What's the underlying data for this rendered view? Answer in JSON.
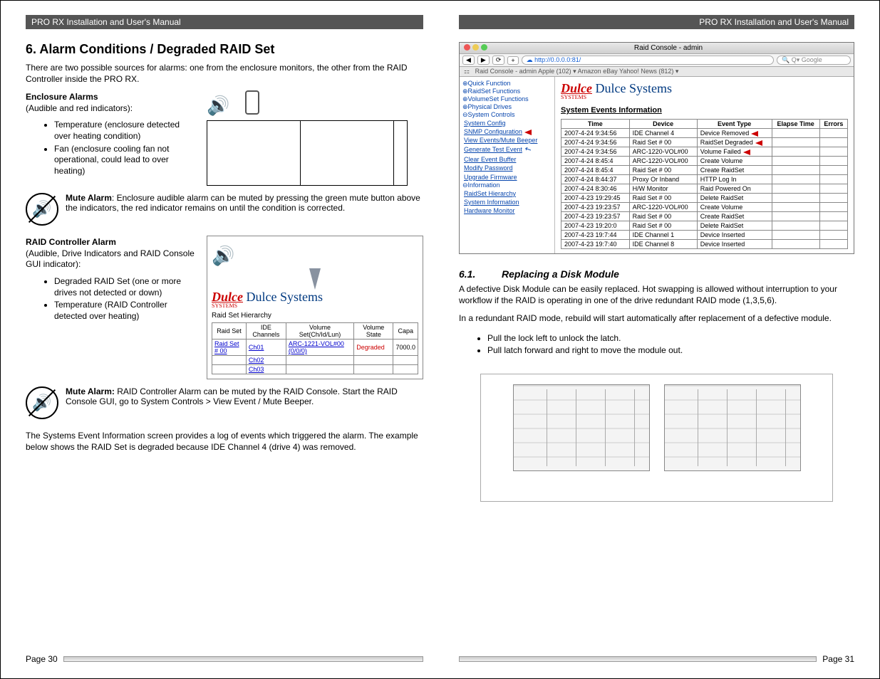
{
  "manual_header": "PRO RX Installation and User's Manual",
  "left": {
    "heading": "6. Alarm Conditions / Degraded RAID Set",
    "intro": "There are two possible sources for alarms: one from the enclosure monitors, the other from the RAID Controller inside the PRO RX.",
    "enc_title": "Enclosure Alarms",
    "enc_sub": "(Audible and red indicators):",
    "enc_bullets": [
      "Temperature (enclosure detected over heating condition)",
      "Fan (enclosure cooling fan not operational, could lead to over heating)"
    ],
    "mute1_lead": "Mute Alarm",
    "mute1": ": Enclosure audible alarm can be muted by pressing the green mute button above the indicators, the red indicator remains on until the condition is corrected.",
    "raid_title": "RAID Controller Alarm",
    "raid_sub": "(Audible, Drive Indicators and RAID Console GUI indicator):",
    "raid_bullets": [
      "Degraded RAID Set (one or more drives not detected or down)",
      "Temperature (RAID Controller detected over heating)"
    ],
    "mute2_lead": "Mute Alarm:",
    "mute2": " RAID Controller Alarm can be muted by the RAID Console.  Start the RAID Console GUI, go to System Controls > View Event / Mute Beeper.",
    "closing": "The Systems Event Information screen provides a log of events which triggered the alarm.  The example below shows the RAID Set is degraded because IDE Channel 4 (drive 4) was removed.",
    "raid_fig": {
      "brand_logo": "Dulce",
      "brand": "Dulce Systems",
      "section": "Raid Set Hierarchy",
      "headers": [
        "Raid Set",
        "IDE Channels",
        "Volume Set(Ch/Id/Lun)",
        "Volume State",
        "Capa"
      ],
      "row": [
        "Raid Set # 00",
        "Ch01",
        "ARC-1221-VOL#00 (0/0/0)",
        "Degraded",
        "7000.0"
      ],
      "extras": [
        "Ch02",
        "Ch03"
      ]
    },
    "page_no": "Page 30"
  },
  "right": {
    "browser": {
      "title": "Raid Console - admin",
      "url": "http://0.0.0.0:81/",
      "search_ph": "Google",
      "bookmarks": "Raid Console - admin    Apple (102) ▾   Amazon   eBay   Yahoo!   News (812) ▾",
      "sidebar_groups": [
        {
          "title": "⊕Quick Function",
          "items": []
        },
        {
          "title": "⊕RaidSet Functions",
          "items": []
        },
        {
          "title": "⊕VolumeSet Functions",
          "items": []
        },
        {
          "title": "⊕Physical Drives",
          "items": []
        },
        {
          "title": "⊖System Controls",
          "items": [
            "System Config",
            "SNMP Configuration",
            "View Events/Mute Beeper",
            "Generate Test Event",
            "Clear Event Buffer",
            "Modify Password",
            "Upgrade Firmware"
          ]
        },
        {
          "title": "⊖Information",
          "items": [
            "RaidSet Hierarchy",
            "System Information",
            "Hardware Monitor"
          ]
        }
      ],
      "brand_logo": "Dulce",
      "brand": "Dulce Systems",
      "table_title": "System Events Information",
      "headers": [
        "Time",
        "Device",
        "Event Type",
        "Elapse Time",
        "Errors"
      ],
      "rows": [
        [
          "2007-4-24 9:34:56",
          "IDE Channel 4",
          "Device Removed",
          "",
          ""
        ],
        [
          "2007-4-24 9:34:56",
          "Raid Set # 00",
          "RaidSet Degraded",
          "",
          ""
        ],
        [
          "2007-4-24 9:34:56",
          "ARC-1220-VOL#00",
          "Volume Failed",
          "",
          ""
        ],
        [
          "2007-4-24 8:45:4",
          "ARC-1220-VOL#00",
          "Create Volume",
          "",
          ""
        ],
        [
          "2007-4-24 8:45:4",
          "Raid Set # 00",
          "Create RaidSet",
          "",
          ""
        ],
        [
          "2007-4-24 8:44:37",
          "Proxy Or Inband",
          "HTTP Log In",
          "",
          ""
        ],
        [
          "2007-4-24 8:30:46",
          "H/W Monitor",
          "Raid Powered On",
          "",
          ""
        ],
        [
          "2007-4-23 19:29:45",
          "Raid Set # 00",
          "Delete RaidSet",
          "",
          ""
        ],
        [
          "2007-4-23 19:23:57",
          "ARC-1220-VOL#00",
          "Create Volume",
          "",
          ""
        ],
        [
          "2007-4-23 19:23:57",
          "Raid Set # 00",
          "Create RaidSet",
          "",
          ""
        ],
        [
          "2007-4-23 19:20:0",
          "Raid Set # 00",
          "Delete RaidSet",
          "",
          ""
        ],
        [
          "2007-4-23 19:7:44",
          "IDE Channel 1",
          "Device Inserted",
          "",
          ""
        ],
        [
          "2007-4-23 19:7:40",
          "IDE Channel 8",
          "Device Inserted",
          "",
          ""
        ]
      ]
    },
    "section_num": "6.1.",
    "section_title": "Replacing a Disk Module",
    "p1": "A defective Disk Module can be easily replaced.  Hot swapping is allowed without interruption to your workflow if the RAID is operating in one of the drive redundant RAID mode (1,3,5,6).",
    "p2": "In a redundant RAID mode, rebuild will start automatically after replacement of a defective module.",
    "bullets": [
      "Pull the lock left to unlock the latch.",
      "Pull latch forward and right to move the module out."
    ],
    "page_no": "Page 31"
  }
}
